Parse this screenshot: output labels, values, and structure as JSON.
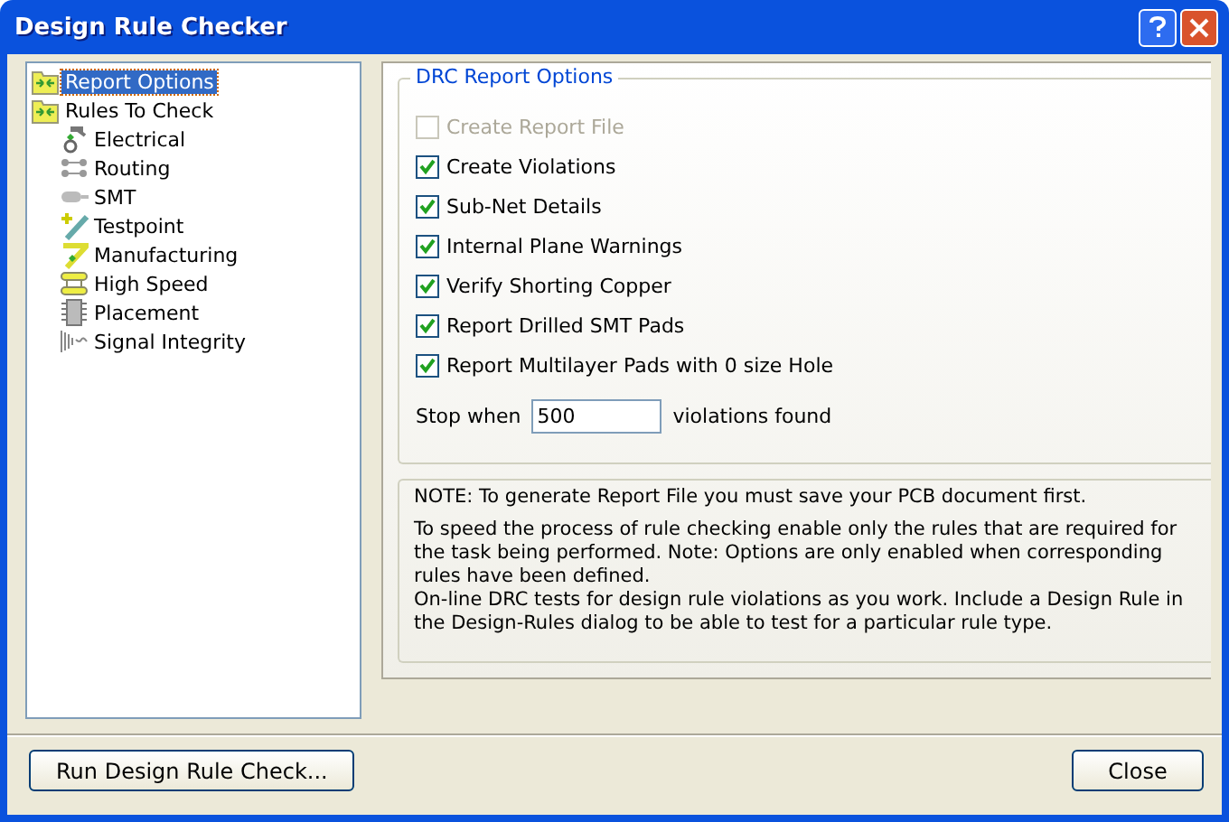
{
  "window": {
    "title": "Design Rule Checker"
  },
  "tree": [
    {
      "label": "Report Options",
      "selected": true
    },
    {
      "label": "Rules To Check",
      "selected": false,
      "children": [
        {
          "label": "Electrical",
          "selected": false
        },
        {
          "label": "Routing",
          "selected": false
        },
        {
          "label": "SMT",
          "selected": false
        },
        {
          "label": "Testpoint",
          "selected": false
        },
        {
          "label": "Manufacturing",
          "selected": false
        },
        {
          "label": "High Speed",
          "selected": false
        },
        {
          "label": "Placement",
          "selected": false
        },
        {
          "label": "Signal Integrity",
          "selected": false
        }
      ]
    }
  ],
  "options_group": {
    "title": "DRC Report Options",
    "options": [
      {
        "label": "Create Report File",
        "checked": false,
        "disabled": true
      },
      {
        "label": "Create Violations",
        "checked": true,
        "disabled": false
      },
      {
        "label": "Sub-Net Details",
        "checked": true,
        "disabled": false
      },
      {
        "label": "Internal Plane Warnings",
        "checked": true,
        "disabled": false
      },
      {
        "label": "Verify Shorting Copper",
        "checked": true,
        "disabled": false
      },
      {
        "label": "Report Drilled SMT Pads",
        "checked": true,
        "disabled": false
      },
      {
        "label": "Report Multilayer Pads with 0 size Hole",
        "checked": true,
        "disabled": false
      }
    ],
    "stop_label": "Stop when",
    "stop_value": "500",
    "stop_suffix": "violations found"
  },
  "notes": [
    "NOTE: To generate Report File you must save your PCB document first.",
    "To speed the process of rule checking enable only the rules that are required for the task being performed.  Note: Options are only enabled when corresponding rules have been defined.",
    "On-line DRC tests for design rule violations as you work. Include a Design Rule in the Design-Rules dialog to be able to test for a particular rule  type."
  ],
  "buttons": [
    "Run Design Rule Check...",
    "Close"
  ]
}
